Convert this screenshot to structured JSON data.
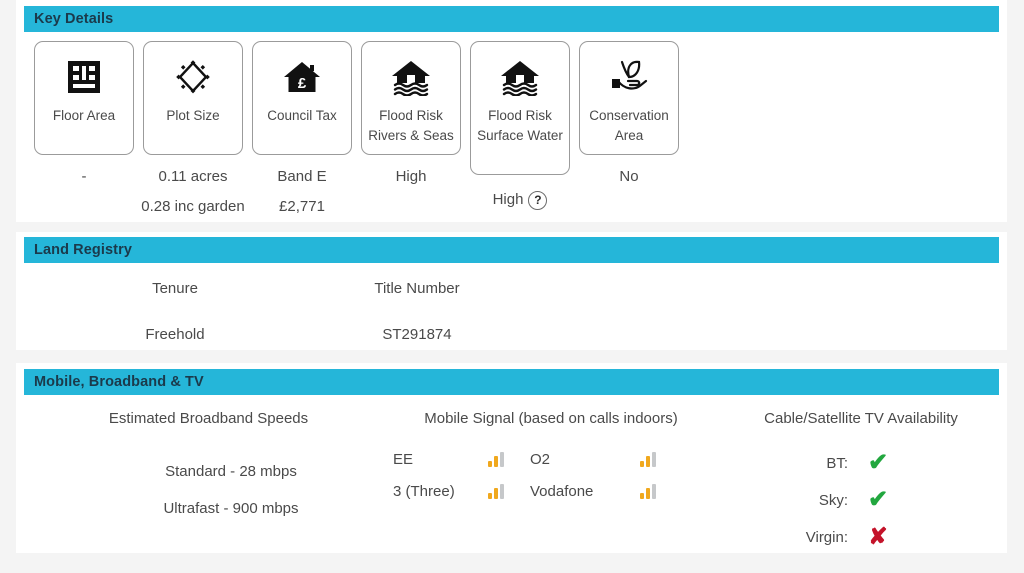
{
  "sections": {
    "key_details": {
      "title": "Key Details",
      "cards": [
        {
          "icon": "floor-area-icon",
          "label": "Floor Area",
          "value_line1": "-",
          "value_line2": ""
        },
        {
          "icon": "plot-size-icon",
          "label": "Plot Size",
          "value_line1": "0.11 acres",
          "value_line2": "0.28 inc garden"
        },
        {
          "icon": "council-tax-icon",
          "label": "Council Tax",
          "value_line1": "Band E",
          "value_line2": "£2,771"
        },
        {
          "icon": "flood-risk-icon",
          "label": "Flood Risk Rivers & Seas",
          "value_line1": "High",
          "value_line2": ""
        },
        {
          "icon": "flood-risk-icon",
          "label": "Flood Risk Surface Water",
          "value_line1": "High",
          "value_line2": "",
          "has_help": true,
          "help_label": "?"
        },
        {
          "icon": "conservation-icon",
          "label": "Conservation Area",
          "value_line1": "No",
          "value_line2": ""
        }
      ]
    },
    "land_registry": {
      "title": "Land Registry",
      "headers": [
        "Tenure",
        "Title Number"
      ],
      "values": [
        "Freehold",
        "ST291874"
      ]
    },
    "mobile_broadband_tv": {
      "title": "Mobile, Broadband & TV",
      "headings": [
        "Estimated Broadband Speeds",
        "Mobile Signal (based on calls indoors)",
        "Cable/Satellite TV Availability"
      ],
      "broadband": [
        "Standard - 28 mbps",
        "Ultrafast - 900 mbps"
      ],
      "mobile_signal": [
        {
          "provider": "EE",
          "icon": "signal-bars-icon",
          "bars": 2
        },
        {
          "provider": "O2",
          "icon": "signal-bars-icon",
          "bars": 2
        },
        {
          "provider": "3 (Three)",
          "icon": "signal-bars-icon",
          "bars": 2
        },
        {
          "provider": "Vodafone",
          "icon": "signal-bars-icon",
          "bars": 2
        }
      ],
      "tv": [
        {
          "provider": "BT:",
          "available": true,
          "mark": "✔"
        },
        {
          "provider": "Sky:",
          "available": true,
          "mark": "✔"
        },
        {
          "provider": "Virgin:",
          "available": false,
          "mark": "✘"
        }
      ]
    }
  },
  "colors": {
    "section_bar": "#25b6d9",
    "page_background": "#f4f4f4",
    "panel": "#ffffff",
    "signal_active": "#f0a81e",
    "signal_inactive": "#c6c8ca",
    "check_green": "#22a73f",
    "cross_red": "#c4132a",
    "text": "#4a4a4a"
  }
}
